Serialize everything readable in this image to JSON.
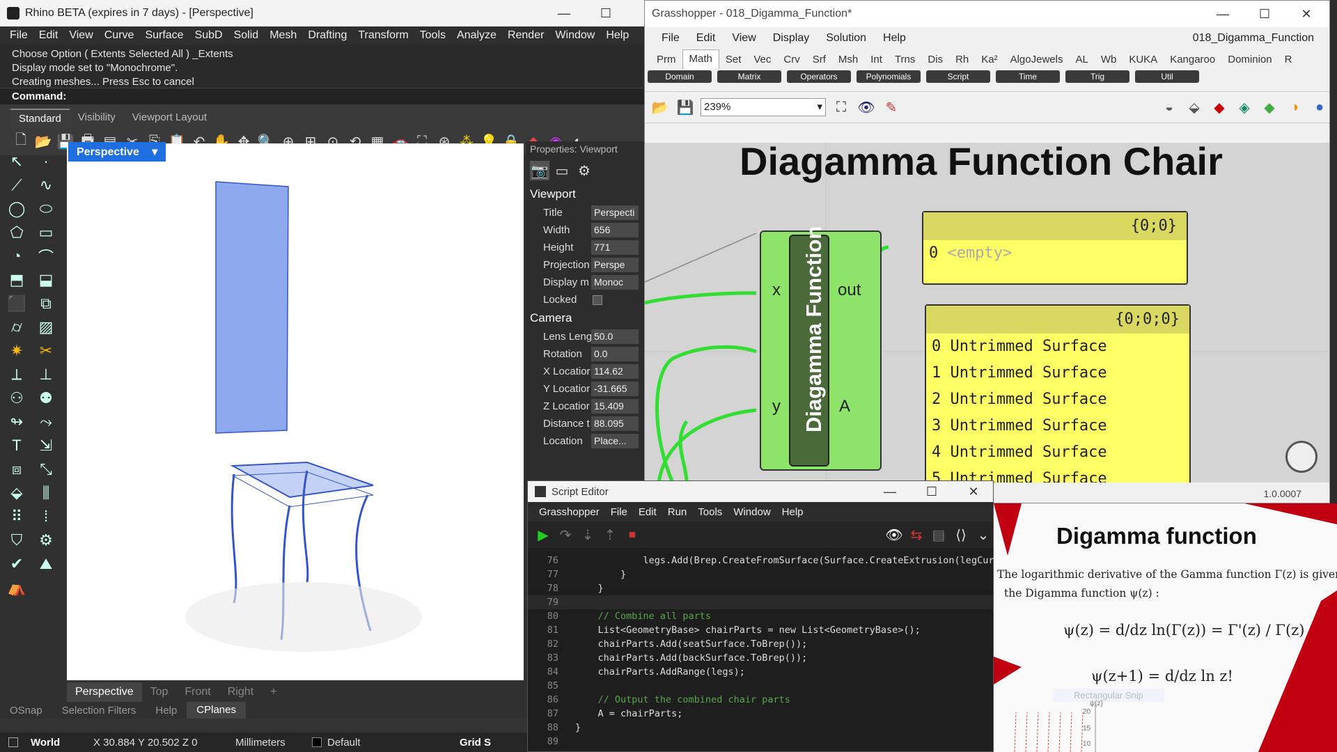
{
  "rhino": {
    "title": "Rhino BETA (expires in 7 days) - [Perspective]",
    "menu": [
      "File",
      "Edit",
      "View",
      "Curve",
      "Surface",
      "SubD",
      "Solid",
      "Mesh",
      "Drafting",
      "Transform",
      "Tools",
      "Analyze",
      "Render",
      "Window",
      "Help"
    ],
    "history": [
      "Choose Option ( Extents  Selected  All ) _Extents",
      "Display mode set to \"Monochrome\".",
      "Creating meshes... Press Esc to cancel"
    ],
    "command_label": "Command:",
    "toolbar_tabs": [
      "Standard",
      "Visibility",
      "Viewport Layout"
    ],
    "viewport_label": "Perspective",
    "viewport_tabs": [
      "Perspective",
      "Top",
      "Front",
      "Right",
      "+"
    ],
    "bottom_tabs": [
      "OSnap",
      "Selection Filters",
      "Help",
      "CPlanes"
    ],
    "status": {
      "cplane": "World",
      "coords": "X 30.884 Y 20.502 Z 0",
      "units": "Millimeters",
      "layer": "Default",
      "grid": "Grid S"
    }
  },
  "props": {
    "header": "Properties: Viewport",
    "viewport_section": "Viewport",
    "camera_section": "Camera",
    "viewport_rows": [
      {
        "k": "Title",
        "v": "Perspecti"
      },
      {
        "k": "Width",
        "v": "656"
      },
      {
        "k": "Height",
        "v": "771"
      },
      {
        "k": "Projection",
        "v": "Perspe"
      },
      {
        "k": "Display m",
        "v": "Monoc"
      },
      {
        "k": "Locked",
        "v": ""
      }
    ],
    "camera_rows": [
      {
        "k": "Lens Leng",
        "v": "50.0"
      },
      {
        "k": "Rotation",
        "v": "0.0"
      },
      {
        "k": "X Locatior",
        "v": "114.62"
      },
      {
        "k": "Y Locatior",
        "v": "-31.665"
      },
      {
        "k": "Z Locatior",
        "v": "15.409"
      },
      {
        "k": "Distance t",
        "v": "88.095"
      },
      {
        "k": "Location",
        "v": "Place..."
      }
    ]
  },
  "gh": {
    "title": "Grasshopper - 018_Digamma_Function*",
    "doc_name": "018_Digamma_Function",
    "menu": [
      "File",
      "Edit",
      "View",
      "Display",
      "Solution",
      "Help"
    ],
    "tabs": [
      "Prm",
      "Math",
      "Set",
      "Vec",
      "Crv",
      "Srf",
      "Msh",
      "Int",
      "Trns",
      "Dis",
      "Rh",
      "Ka²",
      "AlgoJewels",
      "AL",
      "Wb",
      "KUKA",
      "Kangaroo",
      "Dominion",
      "R"
    ],
    "subtabs": [
      "Domain",
      "Matrix",
      "Operators",
      "Polynomials",
      "Script",
      "Time",
      "Trig",
      "Util"
    ],
    "zoom": "239%",
    "canvas_title": "Diagamma Function Chair",
    "component": {
      "name": "Diagamma Function",
      "inputs": [
        "x",
        "y"
      ],
      "outputs": [
        "out",
        "A"
      ]
    },
    "panel1": {
      "path": "{0;0}",
      "rows": [
        {
          "i": "0",
          "t": "<empty>"
        }
      ]
    },
    "panel2": {
      "path": "{0;0;0}",
      "rows": [
        {
          "i": "0",
          "t": "Untrimmed Surface"
        },
        {
          "i": "1",
          "t": "Untrimmed Surface"
        },
        {
          "i": "2",
          "t": "Untrimmed Surface"
        },
        {
          "i": "3",
          "t": "Untrimmed Surface"
        },
        {
          "i": "4",
          "t": "Untrimmed Surface"
        },
        {
          "i": "5",
          "t": "Untrimmed Surface"
        }
      ]
    },
    "version": "1.0.0007"
  },
  "script": {
    "title": "Script Editor",
    "menu": [
      "Grasshopper",
      "File",
      "Edit",
      "Run",
      "Tools",
      "Window",
      "Help"
    ],
    "lines": [
      {
        "n": "76",
        "t": "            legs.Add(Brep.CreateFromSurface(Surface.CreateExtrusion(legCurve"
      },
      {
        "n": "77",
        "t": "        }"
      },
      {
        "n": "78",
        "t": "    }"
      },
      {
        "n": "79",
        "t": ""
      },
      {
        "n": "80",
        "t": "    // Combine all parts"
      },
      {
        "n": "81",
        "t": "    List<GeometryBase> chairParts = new List<GeometryBase>();"
      },
      {
        "n": "82",
        "t": "    chairParts.Add(seatSurface.ToBrep());"
      },
      {
        "n": "83",
        "t": "    chairParts.Add(backSurface.ToBrep());"
      },
      {
        "n": "84",
        "t": "    chairParts.AddRange(legs);"
      },
      {
        "n": "85",
        "t": ""
      },
      {
        "n": "86",
        "t": "    // Output the combined chair parts"
      },
      {
        "n": "87",
        "t": "    A = chairParts;"
      },
      {
        "n": "88",
        "t": "}"
      },
      {
        "n": "89",
        "t": ""
      }
    ]
  },
  "doc": {
    "title": "Digamma function",
    "text1": "The logarithmic derivative of the Gamma function Γ(z) is given by",
    "text2": "the Digamma function ψ(z) :",
    "eq1": "ψ(z) = d/dz ln(Γ(z)) = Γ'(z) / Γ(z)",
    "eq2": "ψ(z+1) = d/dz ln z!",
    "snip": "Rectangular Snip",
    "axis_label": "ψ(z)",
    "ticks": [
      "20",
      "15",
      "10"
    ]
  }
}
